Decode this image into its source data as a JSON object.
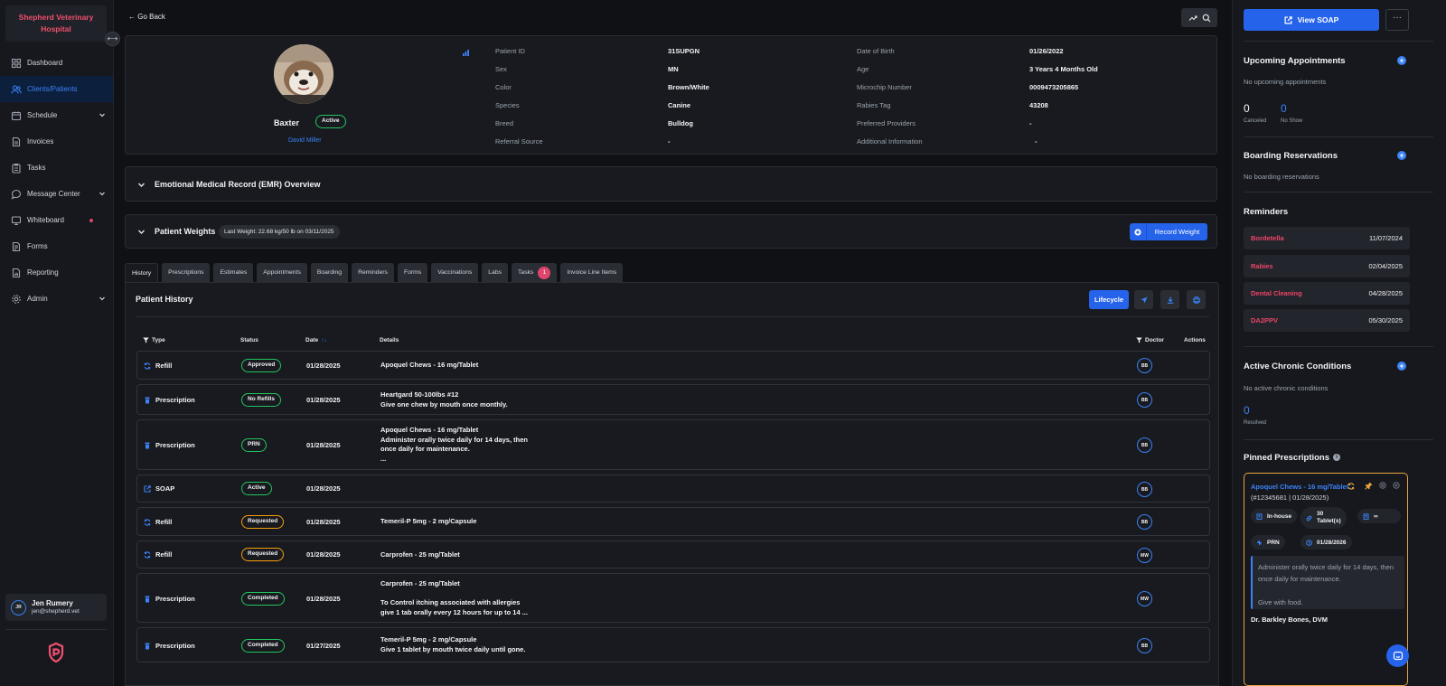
{
  "sidebar": {
    "brand": "Shepherd Veterinary Hospital",
    "collapse_icon": "⟷",
    "items": [
      {
        "label": "Dashboard",
        "icon": "grid-icon"
      },
      {
        "label": "Clients/Patients",
        "icon": "users-icon",
        "active": true
      },
      {
        "label": "Schedule",
        "icon": "calendar-icon",
        "chevron": true
      },
      {
        "label": "Invoices",
        "icon": "invoice-icon"
      },
      {
        "label": "Tasks",
        "icon": "tasks-icon"
      },
      {
        "label": "Message Center",
        "icon": "chat-icon",
        "chevron": true
      },
      {
        "label": "Whiteboard",
        "icon": "monitor-icon",
        "dot": true
      },
      {
        "label": "Forms",
        "icon": "forms-icon"
      },
      {
        "label": "Reporting",
        "icon": "report-icon"
      },
      {
        "label": "Admin",
        "icon": "gear-icon",
        "chevron": true
      }
    ],
    "user": {
      "initials": "JR",
      "name": "Jen Rumery",
      "email": "jen@shepherd.vet"
    }
  },
  "header": {
    "go_back": "← Go Back"
  },
  "patient": {
    "name": "Baxter",
    "status": "Active",
    "owner": "David Miller",
    "fields_left": [
      {
        "label": "Patient ID",
        "value": "31SUPGN"
      },
      {
        "label": "Sex",
        "value": "MN"
      },
      {
        "label": "Color",
        "value": "Brown/White"
      },
      {
        "label": "Species",
        "value": "Canine"
      },
      {
        "label": "Breed",
        "value": "Bulldog"
      },
      {
        "label": "Referral Source",
        "value": "-"
      }
    ],
    "fields_right": [
      {
        "label": "Date of Birth",
        "value": "01/26/2022"
      },
      {
        "label": "Age",
        "value": "3 Years 4 Months Old"
      },
      {
        "label": "Microchip Number",
        "value": "0009473205865"
      },
      {
        "label": "Rabies Tag",
        "value": "43208"
      },
      {
        "label": "Preferred Providers",
        "value": "-"
      },
      {
        "label": "Additional Information",
        "value": "-"
      }
    ]
  },
  "emr": {
    "title": "Emotional Medical Record (EMR) Overview"
  },
  "weights": {
    "title": "Patient Weights",
    "last_weight": "Last Weight: 22.68 kg/50 lb on 03/11/2025",
    "record_button": "Record Weight"
  },
  "tabs": [
    {
      "label": "History",
      "active": true
    },
    {
      "label": "Prescriptions"
    },
    {
      "label": "Estimates"
    },
    {
      "label": "Appointments"
    },
    {
      "label": "Boarding"
    },
    {
      "label": "Reminders"
    },
    {
      "label": "Forms"
    },
    {
      "label": "Vaccinations"
    },
    {
      "label": "Labs"
    },
    {
      "label": "Tasks",
      "badge": "1"
    },
    {
      "label": "Invoice Line Items"
    }
  ],
  "history": {
    "title": "Patient History",
    "lifecycle_button": "Lifecycle",
    "columns": {
      "type": "Type",
      "status": "Status",
      "date": "Date",
      "date_sort": "↑↓",
      "details": "Details",
      "doctor": "Doctor",
      "actions": "Actions"
    },
    "rows": [
      {
        "type": "Refill",
        "icon": "refresh-icon",
        "status": "Approved",
        "status_color": "#22c55e",
        "date": "01/28/2025",
        "details": [
          "Apoquel Chews - 16 mg/Tablet"
        ],
        "doctor": "BB"
      },
      {
        "type": "Prescription",
        "icon": "prescription-icon",
        "status": "No Refills",
        "status_color": "#22c55e",
        "date": "01/28/2025",
        "details": [
          "Heartgard 50-100lbs #12",
          "Give one chew by mouth once monthly."
        ],
        "doctor": "BB"
      },
      {
        "type": "Prescription",
        "icon": "prescription-icon",
        "status": "PRN",
        "status_color": "#22c55e",
        "date": "01/28/2025",
        "details": [
          "Apoquel Chews - 16 mg/Tablet",
          "Administer orally twice daily for 14 days, then",
          "once daily for maintenance.",
          "..."
        ],
        "doctor": "BB"
      },
      {
        "type": "SOAP",
        "icon": "external-link-icon",
        "status": "Active",
        "status_color": "#22c55e",
        "date": "01/28/2025",
        "details": [],
        "doctor": "BB"
      },
      {
        "type": "Refill",
        "icon": "refresh-icon",
        "status": "Requested",
        "status_color": "#f59e0b",
        "date": "01/28/2025",
        "details": [
          "Temeril-P 5mg - 2 mg/Capsule"
        ],
        "doctor": "BB"
      },
      {
        "type": "Refill",
        "icon": "refresh-icon",
        "status": "Requested",
        "status_color": "#f59e0b",
        "date": "01/28/2025",
        "details": [
          "Carprofen - 25 mg/Tablet"
        ],
        "doctor": "MW"
      },
      {
        "type": "Prescription",
        "icon": "prescription-icon",
        "status": "Completed",
        "status_color": "#22c55e",
        "date": "01/28/2025",
        "details": [
          "Carprofen - 25 mg/Tablet",
          "",
          "To Control itching associated with allergies",
          "give 1 tab orally every 12 hours for up to 14 ..."
        ],
        "doctor": "MW"
      },
      {
        "type": "Prescription",
        "icon": "prescription-icon",
        "status": "Completed",
        "status_color": "#22c55e",
        "date": "01/27/2025",
        "details": [
          "Temeril-P 5mg - 2 mg/Capsule",
          "Give 1 tablet by mouth twice daily until gone."
        ],
        "doctor": "BB"
      }
    ]
  },
  "right": {
    "view_soap": "View SOAP",
    "more": "···",
    "upcoming": {
      "title": "Upcoming Appointments",
      "empty": "No upcoming appointments",
      "canceled": "0",
      "canceled_label": "Canceled",
      "no_show": "0",
      "no_show_label": "No Show"
    },
    "boarding": {
      "title": "Boarding Reservations",
      "empty": "No boarding reservations"
    },
    "reminders": {
      "title": "Reminders",
      "items": [
        {
          "name": "Bordetella",
          "date": "11/07/2024"
        },
        {
          "name": "Rabies",
          "date": "02/04/2025"
        },
        {
          "name": "Dental Cleaning",
          "date": "04/28/2025"
        },
        {
          "name": "DA2PPV",
          "date": "05/30/2025"
        }
      ]
    },
    "chronic": {
      "title": "Active Chronic Conditions",
      "empty": "No active chronic conditions",
      "resolved": "0",
      "resolved_label": "Resolved"
    },
    "pinned": {
      "title": "Pinned Prescriptions",
      "name": "Apoquel Chews - 16 mg/Tablet",
      "sub": "(#12345681  |  01/28/2025)",
      "chip_inhouse": "In-house",
      "chip_qty_1": "30",
      "chip_qty_2": "Tablet(s)",
      "chip_refills": "∞",
      "chip_prn": "PRN",
      "chip_date": "01/28/2026",
      "note_1": "Administer orally twice daily for 14 days, then",
      "note_2": "once daily for maintenance.",
      "note_3": "Give with food.",
      "doctor": "Dr. Barkley Bones, DVM"
    }
  },
  "colors": {
    "accent": "#2563eb",
    "brand": "#f0506e",
    "approved": "#22c55e",
    "requested": "#f59e0b",
    "reminder": "#ef4468",
    "pinned_border": "#e8a33d"
  }
}
